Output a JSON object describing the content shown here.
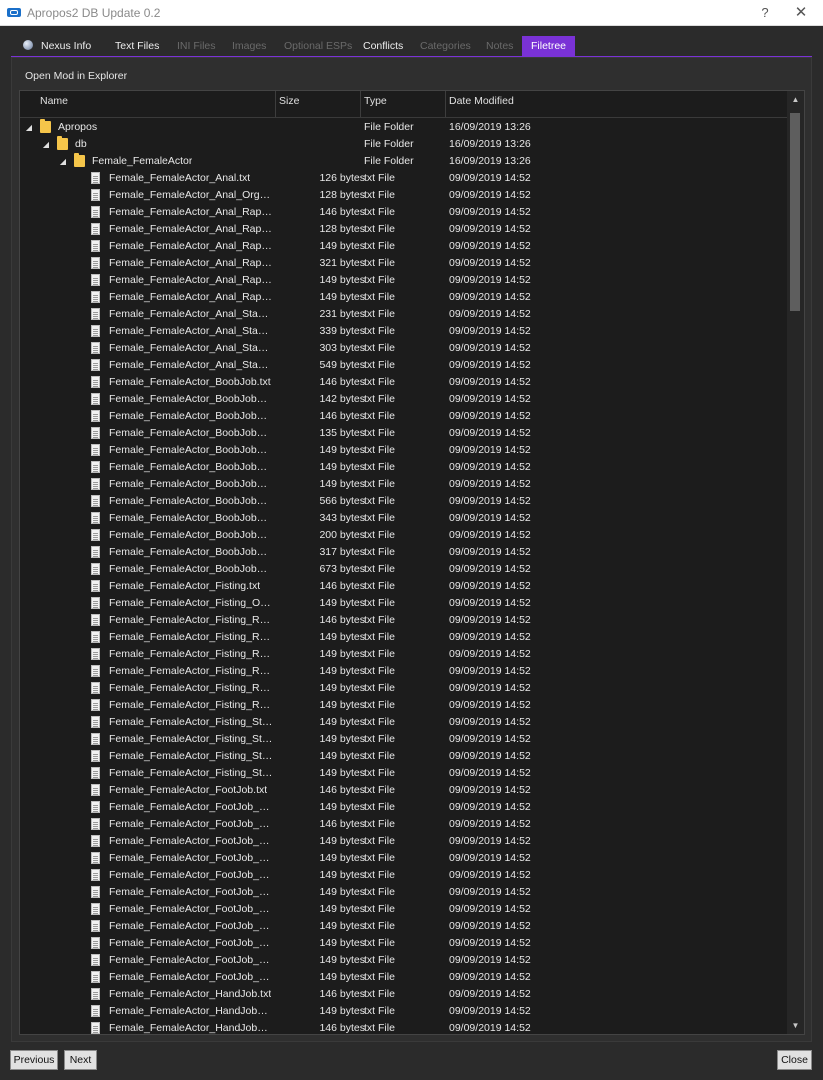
{
  "window": {
    "title": "Apropos2 DB Update 0.2",
    "help_label": "?",
    "close_label": "✕"
  },
  "tabs": [
    {
      "label": "Nexus Info",
      "state": "on"
    },
    {
      "label": "Text Files",
      "state": "on"
    },
    {
      "label": "INI Files",
      "state": "off"
    },
    {
      "label": "Images",
      "state": "off"
    },
    {
      "label": "Optional ESPs",
      "state": "off"
    },
    {
      "label": "Conflicts",
      "state": "on"
    },
    {
      "label": "Categories",
      "state": "off"
    },
    {
      "label": "Notes",
      "state": "off"
    },
    {
      "label": "Filetree",
      "state": "active"
    }
  ],
  "toolbar": {
    "open_mod_label": "Open Mod in Explorer"
  },
  "tree": {
    "columns": {
      "name": "Name",
      "size": "Size",
      "type": "Type",
      "date": "Date Modified"
    },
    "rows": [
      {
        "depth": 0,
        "kind": "folder",
        "expanded": true,
        "name": "Apropos",
        "size": "",
        "type": "File Folder",
        "date": "16/09/2019 13:26"
      },
      {
        "depth": 1,
        "kind": "folder",
        "expanded": true,
        "name": "db",
        "size": "",
        "type": "File Folder",
        "date": "16/09/2019 13:26"
      },
      {
        "depth": 2,
        "kind": "folder",
        "expanded": true,
        "name": "Female_FemaleActor",
        "size": "",
        "type": "File Folder",
        "date": "16/09/2019 13:26"
      },
      {
        "depth": 3,
        "kind": "file",
        "name": "Female_FemaleActor_Anal.txt",
        "size": "126 bytes",
        "type": "txt File",
        "date": "09/09/2019 14:52"
      },
      {
        "depth": 3,
        "kind": "file",
        "name": "Female_FemaleActor_Anal_Orgas...",
        "size": "128 bytes",
        "type": "txt File",
        "date": "09/09/2019 14:52"
      },
      {
        "depth": 3,
        "kind": "file",
        "name": "Female_FemaleActor_Anal_Rape.txt",
        "size": "146 bytes",
        "type": "txt File",
        "date": "09/09/2019 14:52"
      },
      {
        "depth": 3,
        "kind": "file",
        "name": "Female_FemaleActor_Anal_Rape_...",
        "size": "128 bytes",
        "type": "txt File",
        "date": "09/09/2019 14:52"
      },
      {
        "depth": 3,
        "kind": "file",
        "name": "Female_FemaleActor_Anal_Rape_S...",
        "size": "149 bytes",
        "type": "txt File",
        "date": "09/09/2019 14:52"
      },
      {
        "depth": 3,
        "kind": "file",
        "name": "Female_FemaleActor_Anal_Rape_S...",
        "size": "321 bytes",
        "type": "txt File",
        "date": "09/09/2019 14:52"
      },
      {
        "depth": 3,
        "kind": "file",
        "name": "Female_FemaleActor_Anal_Rape_S...",
        "size": "149 bytes",
        "type": "txt File",
        "date": "09/09/2019 14:52"
      },
      {
        "depth": 3,
        "kind": "file",
        "name": "Female_FemaleActor_Anal_Rape_S...",
        "size": "149 bytes",
        "type": "txt File",
        "date": "09/09/2019 14:52"
      },
      {
        "depth": 3,
        "kind": "file",
        "name": "Female_FemaleActor_Anal_Stage1....",
        "size": "231 bytes",
        "type": "txt File",
        "date": "09/09/2019 14:52"
      },
      {
        "depth": 3,
        "kind": "file",
        "name": "Female_FemaleActor_Anal_Stage2....",
        "size": "339 bytes",
        "type": "txt File",
        "date": "09/09/2019 14:52"
      },
      {
        "depth": 3,
        "kind": "file",
        "name": "Female_FemaleActor_Anal_Stage3....",
        "size": "303 bytes",
        "type": "txt File",
        "date": "09/09/2019 14:52"
      },
      {
        "depth": 3,
        "kind": "file",
        "name": "Female_FemaleActor_Anal_Stage4....",
        "size": "549 bytes",
        "type": "txt File",
        "date": "09/09/2019 14:52"
      },
      {
        "depth": 3,
        "kind": "file",
        "name": "Female_FemaleActor_BoobJob.txt",
        "size": "146 bytes",
        "type": "txt File",
        "date": "09/09/2019 14:52"
      },
      {
        "depth": 3,
        "kind": "file",
        "name": "Female_FemaleActor_BoobJob_Or...",
        "size": "142 bytes",
        "type": "txt File",
        "date": "09/09/2019 14:52"
      },
      {
        "depth": 3,
        "kind": "file",
        "name": "Female_FemaleActor_BoobJob_Ra...",
        "size": "146 bytes",
        "type": "txt File",
        "date": "09/09/2019 14:52"
      },
      {
        "depth": 3,
        "kind": "file",
        "name": "Female_FemaleActor_BoobJob_Ra...",
        "size": "135 bytes",
        "type": "txt File",
        "date": "09/09/2019 14:52"
      },
      {
        "depth": 3,
        "kind": "file",
        "name": "Female_FemaleActor_BoobJob_Ra...",
        "size": "149 bytes",
        "type": "txt File",
        "date": "09/09/2019 14:52"
      },
      {
        "depth": 3,
        "kind": "file",
        "name": "Female_FemaleActor_BoobJob_Ra...",
        "size": "149 bytes",
        "type": "txt File",
        "date": "09/09/2019 14:52"
      },
      {
        "depth": 3,
        "kind": "file",
        "name": "Female_FemaleActor_BoobJob_Ra...",
        "size": "149 bytes",
        "type": "txt File",
        "date": "09/09/2019 14:52"
      },
      {
        "depth": 3,
        "kind": "file",
        "name": "Female_FemaleActor_BoobJob_Ra...",
        "size": "566 bytes",
        "type": "txt File",
        "date": "09/09/2019 14:52"
      },
      {
        "depth": 3,
        "kind": "file",
        "name": "Female_FemaleActor_BoobJob_Sta...",
        "size": "343 bytes",
        "type": "txt File",
        "date": "09/09/2019 14:52"
      },
      {
        "depth": 3,
        "kind": "file",
        "name": "Female_FemaleActor_BoobJob_Sta...",
        "size": "200 bytes",
        "type": "txt File",
        "date": "09/09/2019 14:52"
      },
      {
        "depth": 3,
        "kind": "file",
        "name": "Female_FemaleActor_BoobJob_Sta...",
        "size": "317 bytes",
        "type": "txt File",
        "date": "09/09/2019 14:52"
      },
      {
        "depth": 3,
        "kind": "file",
        "name": "Female_FemaleActor_BoobJob_Sta...",
        "size": "673 bytes",
        "type": "txt File",
        "date": "09/09/2019 14:52"
      },
      {
        "depth": 3,
        "kind": "file",
        "name": "Female_FemaleActor_Fisting.txt",
        "size": "146 bytes",
        "type": "txt File",
        "date": "09/09/2019 14:52"
      },
      {
        "depth": 3,
        "kind": "file",
        "name": "Female_FemaleActor_Fisting_Orga...",
        "size": "149 bytes",
        "type": "txt File",
        "date": "09/09/2019 14:52"
      },
      {
        "depth": 3,
        "kind": "file",
        "name": "Female_FemaleActor_Fisting_Rape...",
        "size": "146 bytes",
        "type": "txt File",
        "date": "09/09/2019 14:52"
      },
      {
        "depth": 3,
        "kind": "file",
        "name": "Female_FemaleActor_Fisting_Rape...",
        "size": "149 bytes",
        "type": "txt File",
        "date": "09/09/2019 14:52"
      },
      {
        "depth": 3,
        "kind": "file",
        "name": "Female_FemaleActor_Fisting_Rape...",
        "size": "149 bytes",
        "type": "txt File",
        "date": "09/09/2019 14:52"
      },
      {
        "depth": 3,
        "kind": "file",
        "name": "Female_FemaleActor_Fisting_Rape...",
        "size": "149 bytes",
        "type": "txt File",
        "date": "09/09/2019 14:52"
      },
      {
        "depth": 3,
        "kind": "file",
        "name": "Female_FemaleActor_Fisting_Rape...",
        "size": "149 bytes",
        "type": "txt File",
        "date": "09/09/2019 14:52"
      },
      {
        "depth": 3,
        "kind": "file",
        "name": "Female_FemaleActor_Fisting_Rape...",
        "size": "149 bytes",
        "type": "txt File",
        "date": "09/09/2019 14:52"
      },
      {
        "depth": 3,
        "kind": "file",
        "name": "Female_FemaleActor_Fisting_Stag...",
        "size": "149 bytes",
        "type": "txt File",
        "date": "09/09/2019 14:52"
      },
      {
        "depth": 3,
        "kind": "file",
        "name": "Female_FemaleActor_Fisting_Stag...",
        "size": "149 bytes",
        "type": "txt File",
        "date": "09/09/2019 14:52"
      },
      {
        "depth": 3,
        "kind": "file",
        "name": "Female_FemaleActor_Fisting_Stag...",
        "size": "149 bytes",
        "type": "txt File",
        "date": "09/09/2019 14:52"
      },
      {
        "depth": 3,
        "kind": "file",
        "name": "Female_FemaleActor_Fisting_Stag...",
        "size": "149 bytes",
        "type": "txt File",
        "date": "09/09/2019 14:52"
      },
      {
        "depth": 3,
        "kind": "file",
        "name": "Female_FemaleActor_FootJob.txt",
        "size": "146 bytes",
        "type": "txt File",
        "date": "09/09/2019 14:52"
      },
      {
        "depth": 3,
        "kind": "file",
        "name": "Female_FemaleActor_FootJob_Org...",
        "size": "149 bytes",
        "type": "txt File",
        "date": "09/09/2019 14:52"
      },
      {
        "depth": 3,
        "kind": "file",
        "name": "Female_FemaleActor_FootJob_Rap...",
        "size": "146 bytes",
        "type": "txt File",
        "date": "09/09/2019 14:52"
      },
      {
        "depth": 3,
        "kind": "file",
        "name": "Female_FemaleActor_FootJob_Rap...",
        "size": "149 bytes",
        "type": "txt File",
        "date": "09/09/2019 14:52"
      },
      {
        "depth": 3,
        "kind": "file",
        "name": "Female_FemaleActor_FootJob_Rap...",
        "size": "149 bytes",
        "type": "txt File",
        "date": "09/09/2019 14:52"
      },
      {
        "depth": 3,
        "kind": "file",
        "name": "Female_FemaleActor_FootJob_Rap...",
        "size": "149 bytes",
        "type": "txt File",
        "date": "09/09/2019 14:52"
      },
      {
        "depth": 3,
        "kind": "file",
        "name": "Female_FemaleActor_FootJob_Rap...",
        "size": "149 bytes",
        "type": "txt File",
        "date": "09/09/2019 14:52"
      },
      {
        "depth": 3,
        "kind": "file",
        "name": "Female_FemaleActor_FootJob_Rap...",
        "size": "149 bytes",
        "type": "txt File",
        "date": "09/09/2019 14:52"
      },
      {
        "depth": 3,
        "kind": "file",
        "name": "Female_FemaleActor_FootJob_Sta...",
        "size": "149 bytes",
        "type": "txt File",
        "date": "09/09/2019 14:52"
      },
      {
        "depth": 3,
        "kind": "file",
        "name": "Female_FemaleActor_FootJob_Sta...",
        "size": "149 bytes",
        "type": "txt File",
        "date": "09/09/2019 14:52"
      },
      {
        "depth": 3,
        "kind": "file",
        "name": "Female_FemaleActor_FootJob_Sta...",
        "size": "149 bytes",
        "type": "txt File",
        "date": "09/09/2019 14:52"
      },
      {
        "depth": 3,
        "kind": "file",
        "name": "Female_FemaleActor_FootJob_Sta...",
        "size": "149 bytes",
        "type": "txt File",
        "date": "09/09/2019 14:52"
      },
      {
        "depth": 3,
        "kind": "file",
        "name": "Female_FemaleActor_HandJob.txt",
        "size": "146 bytes",
        "type": "txt File",
        "date": "09/09/2019 14:52"
      },
      {
        "depth": 3,
        "kind": "file",
        "name": "Female_FemaleActor_HandJob_Or...",
        "size": "149 bytes",
        "type": "txt File",
        "date": "09/09/2019 14:52"
      },
      {
        "depth": 3,
        "kind": "file",
        "name": "Female_FemaleActor_HandJob_Ra...",
        "size": "146 bytes",
        "type": "txt File",
        "date": "09/09/2019 14:52"
      }
    ]
  },
  "footer": {
    "previous_label": "Previous",
    "next_label": "Next",
    "close_label": "Close"
  },
  "colors": {
    "accent": "#7a32d6",
    "folder": "#f5c54a",
    "background": "#2b2b2b",
    "tree_background": "#1c1c1c"
  }
}
